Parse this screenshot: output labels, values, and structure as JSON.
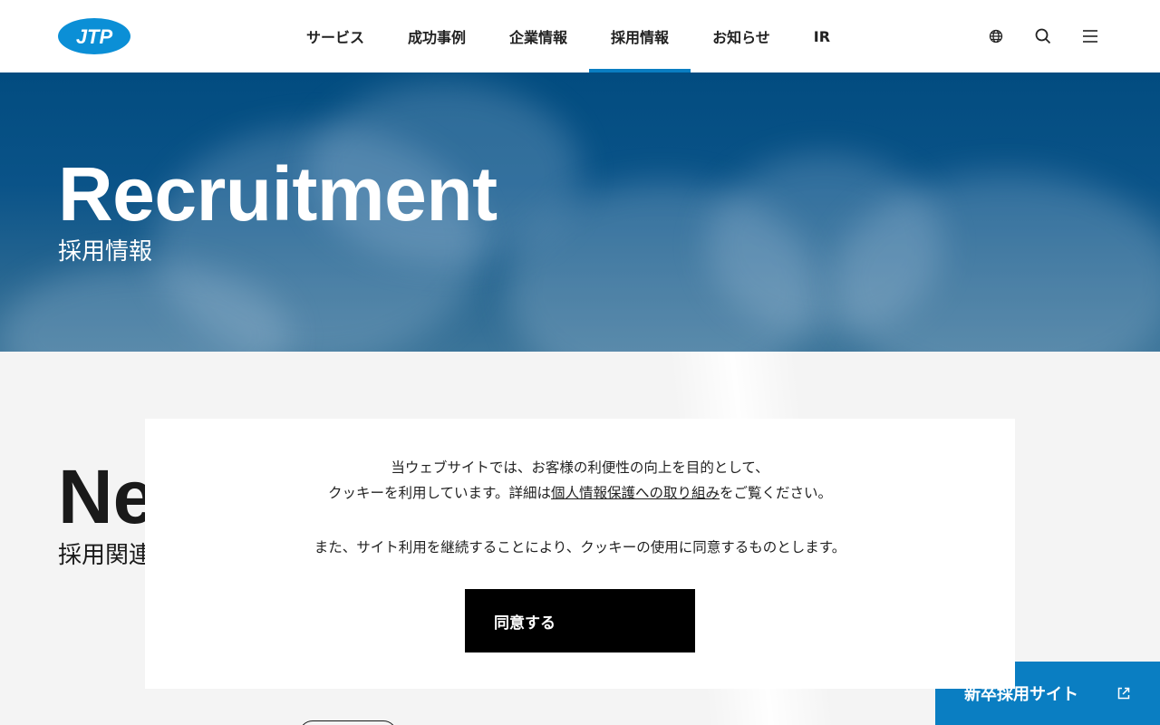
{
  "brand": {
    "logo_text": "JTP",
    "accent": "#0a7ec2",
    "logo_color": "#0b8fd6"
  },
  "nav": {
    "items": [
      {
        "label": "サービス"
      },
      {
        "label": "成功事例"
      },
      {
        "label": "企業情報"
      },
      {
        "label": "採用情報",
        "active": true
      },
      {
        "label": "お知らせ"
      },
      {
        "label": "IR"
      }
    ],
    "icons": [
      "globe-icon",
      "search-icon",
      "menu-icon"
    ]
  },
  "hero": {
    "title": "Recruitment",
    "subtitle": "採用情報"
  },
  "section": {
    "title": "Ne",
    "subtitle": "採用関連"
  },
  "cookie": {
    "line1": "当ウェブサイトでは、お客様の利便性の向上を目的として、",
    "line2_before": "クッキーを利用しています。詳細は",
    "line2_link": "個人情報保護への取り組み",
    "line2_after": "をご覧ください。",
    "line3": "また、サイト利用を継続することにより、クッキーの使用に同意するものとします。",
    "agree_label": "同意する"
  },
  "recruit_tab": {
    "label": "新卒採用サイト",
    "icon": "external-link-icon"
  }
}
